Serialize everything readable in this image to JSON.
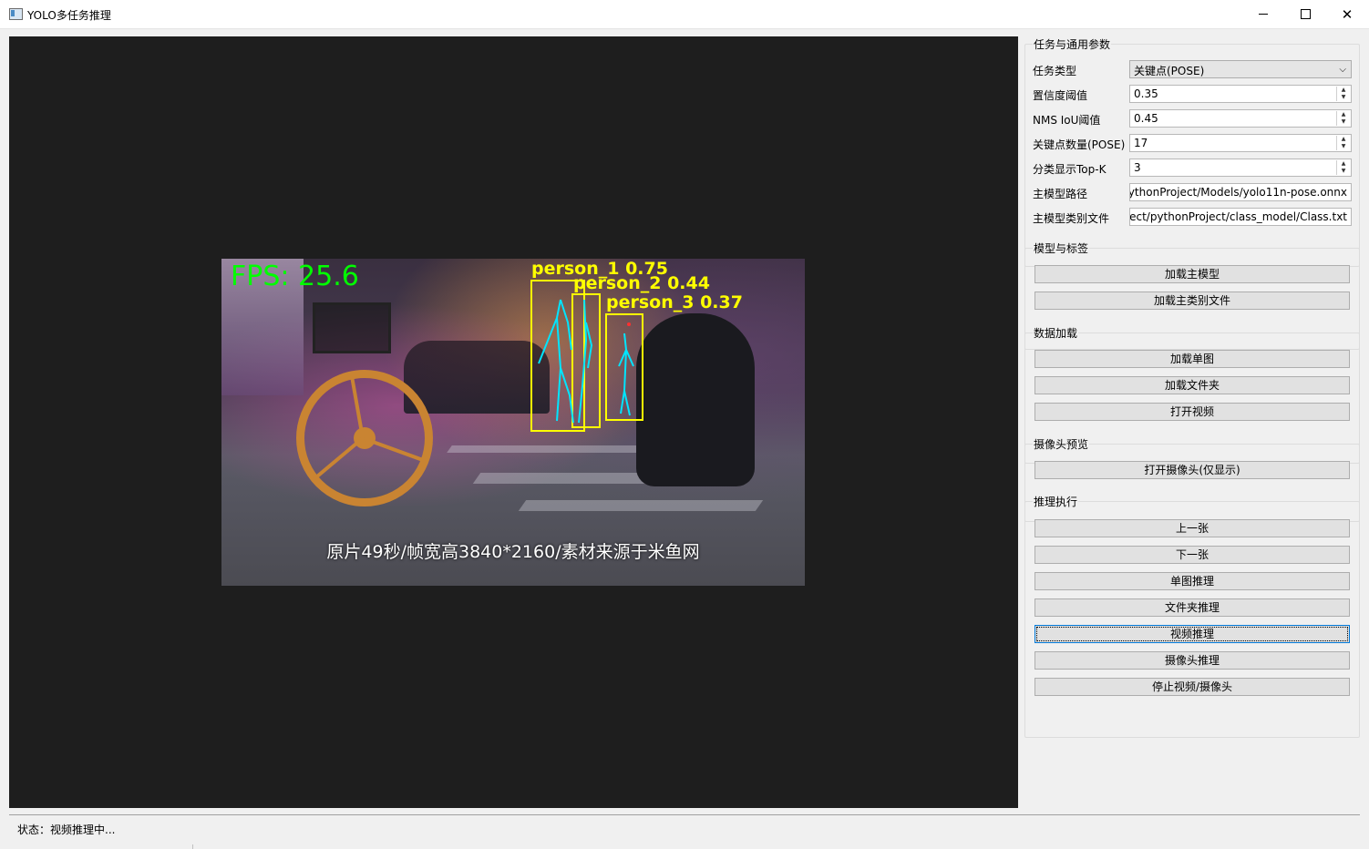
{
  "window": {
    "title": "YOLO多任务推理",
    "controls": {
      "minimize": "minimize-icon",
      "maximize": "maximize-icon",
      "close": "close-icon"
    }
  },
  "video": {
    "fps_text": "FPS: 25.6",
    "subtitle": "原片49秒/帧宽高3840*2160/素材来源于米鱼网",
    "detections": [
      {
        "label": "person_1 0.75"
      },
      {
        "label": "person_2 0.44"
      },
      {
        "label": "person_3 0.37"
      }
    ],
    "box_color": "#ffff00",
    "skeleton_color": "#00e5ff",
    "fps_color": "#00ff00"
  },
  "params": {
    "title": "任务与通用参数",
    "task_type": {
      "label": "任务类型",
      "value": "关键点(POSE)"
    },
    "conf": {
      "label": "置信度阈值",
      "value": "0.35"
    },
    "iou": {
      "label": "NMS IoU阈值",
      "value": "0.45"
    },
    "kpts": {
      "label": "关键点数量(POSE)",
      "value": "17"
    },
    "topk": {
      "label": "分类显示Top-K",
      "value": "3"
    },
    "model_path": {
      "label": "主模型路径",
      "value": "ythonProject/Models/yolo11n-pose.onnx"
    },
    "class_file": {
      "label": "主模型类别文件",
      "value": "oject/pythonProject/class_model/Class.txt"
    }
  },
  "model_group": {
    "title": "模型与标签",
    "load_model": "加载主模型",
    "load_classes": "加载主类别文件"
  },
  "data_group": {
    "title": "数据加载",
    "load_image": "加载单图",
    "load_folder": "加载文件夹",
    "open_video": "打开视频"
  },
  "camera_group": {
    "title": "摄像头预览",
    "open_camera": "打开摄像头(仅显示)"
  },
  "infer_group": {
    "title": "推理执行",
    "prev": "上一张",
    "next": "下一张",
    "single": "单图推理",
    "folder": "文件夹推理",
    "video": "视频推理",
    "camera": "摄像头推理",
    "stop": "停止视频/摄像头"
  },
  "status": {
    "text": "状态：视频推理中..."
  }
}
